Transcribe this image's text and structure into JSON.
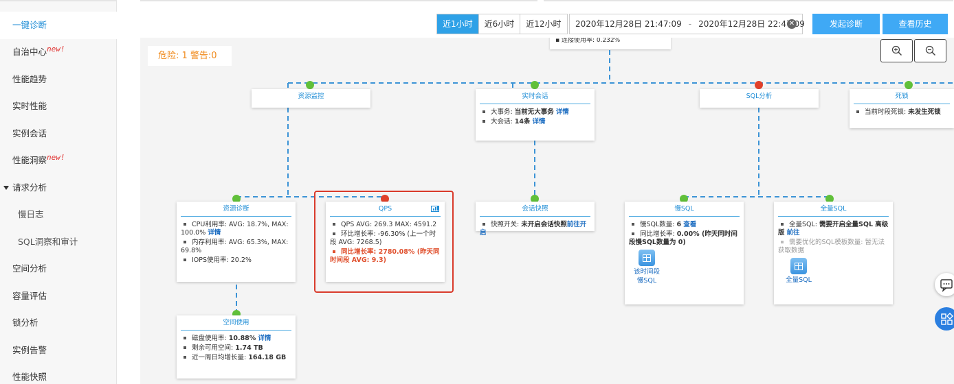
{
  "sidebar": {
    "items": [
      {
        "label": "一键诊断",
        "active": true
      },
      {
        "label": "自治中心",
        "badge": "new!"
      },
      {
        "label": "性能趋势"
      },
      {
        "label": "实时性能"
      },
      {
        "label": "实例会话"
      },
      {
        "label": "性能洞察",
        "badge": "new!"
      },
      {
        "label": "请求分析",
        "expanded": true
      },
      {
        "label": "慢日志",
        "sub": true
      },
      {
        "label": "SQL洞察和审计",
        "sub": true
      },
      {
        "label": "空间分析"
      },
      {
        "label": "容量评估"
      },
      {
        "label": "锁分析"
      },
      {
        "label": "实例告警"
      },
      {
        "label": "性能快照"
      }
    ]
  },
  "toolbar": {
    "ranges": [
      "近1小时",
      "近6小时",
      "近12小时"
    ],
    "active_range": "近1小时",
    "start_time": "2020年12月28日 21:47:09",
    "separator": "-",
    "end_time": "2020年12月28日 22:47:09",
    "diagnose_label": "发起诊断",
    "history_label": "查看历史"
  },
  "risk": {
    "label": "危险: 1 警告:0"
  },
  "top_card_partial": "▪  连接使用率: 0.232%",
  "cards": {
    "resource_monitor": {
      "title": "资源监控"
    },
    "realtime_session": {
      "title": "实时会话",
      "items": [
        {
          "prefix": "大事务: ",
          "value": "当前无大事务",
          "link": "详情"
        },
        {
          "prefix": "大会话: ",
          "value": "14条",
          "link": "详情"
        }
      ]
    },
    "sql_analysis": {
      "title": "SQL分析"
    },
    "deadlock": {
      "title": "死锁",
      "items": [
        {
          "prefix": "当前时段死锁: ",
          "value": "未发生死锁"
        }
      ]
    },
    "resource_diag": {
      "title": "资源诊断",
      "items": [
        {
          "prefix": "CPU利用率: AVG: 18.7%, MAX: 100.0% ",
          "link": "详情"
        },
        {
          "prefix": "内存利用率: AVG: 65.3%, MAX: 69.8%"
        },
        {
          "prefix": "IOPS使用率: 20.2%"
        }
      ]
    },
    "qps": {
      "title": "QPS",
      "items": [
        {
          "prefix": "QPS AVG: 269.3 MAX: 4591.2"
        },
        {
          "prefix": "环比增长率: -96.30% (上一个时段 AVG: 7268.5)"
        },
        {
          "prefix": "同比增长率: 2780.08% (昨天同时间段 AVG: 9.3)",
          "alert": true
        }
      ]
    },
    "session_snapshot": {
      "title": "会话快照",
      "items": [
        {
          "prefix": "快照开关: ",
          "value": "未开启会话快照",
          "link": "前往开启"
        }
      ]
    },
    "slow_sql": {
      "title": "慢SQL",
      "items": [
        {
          "prefix": "慢SQL数量: ",
          "value": "6",
          "link": "查看"
        },
        {
          "prefix": "同比增长率: ",
          "value": "0.00% (昨天同时间段慢SQL数量为 0)"
        }
      ],
      "icon_label_1": "该时间段",
      "icon_label_2": "慢SQL"
    },
    "full_sql": {
      "title": "全量SQL",
      "items": [
        {
          "prefix": "全量SQL: ",
          "value": "需要开启全量SQL 高级版",
          "link": "前往"
        },
        {
          "prefix": "需要优化的SQL模板数量: 暂无法获取数据",
          "muted": true
        }
      ],
      "icon_label": "全量SQL"
    },
    "space_usage": {
      "title": "空间使用",
      "items": [
        {
          "prefix": "磁盘使用率: ",
          "value": "10.88%",
          "link": "详情"
        },
        {
          "prefix": "剩余可用空间: ",
          "value": "1.74 TB"
        },
        {
          "prefix": "近一周日均增长量: ",
          "value": "164.18 GB"
        }
      ]
    }
  },
  "colors": {
    "accent": "#1f8dd6",
    "alert": "#e0512f",
    "warning_text": "#f08a1c",
    "button": "#3fa9f5"
  }
}
